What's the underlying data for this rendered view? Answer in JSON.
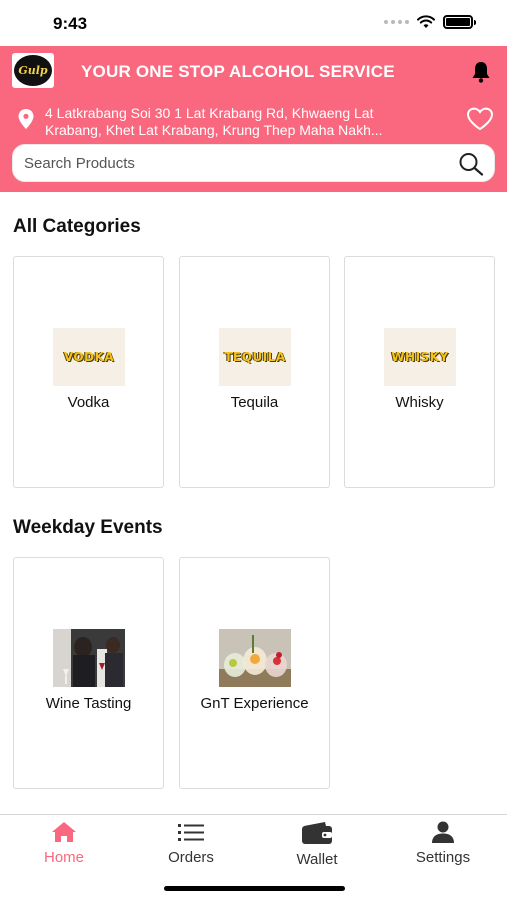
{
  "status_bar": {
    "time": "9:43"
  },
  "header": {
    "tagline": "YOUR ONE STOP ALCOHOL SERVICE",
    "logo_text": "Gulp",
    "address_line1": "4 Latkrabang Soi 30 1 Lat Krabang Rd, Khwaeng Lat",
    "address_line2": "Krabang, Khet Lat Krabang, Krung Thep Maha Nakh...",
    "search_placeholder": "Search Products"
  },
  "categories": {
    "title": "All Categories",
    "items": [
      {
        "label": "Vodka",
        "image_text": "VODKA"
      },
      {
        "label": "Tequila",
        "image_text": "TEQUILA"
      },
      {
        "label": "Whisky",
        "image_text": "WHISKY"
      }
    ]
  },
  "events": {
    "title": "Weekday Events",
    "items": [
      {
        "label": "Wine Tasting"
      },
      {
        "label": "GnT Experience"
      }
    ]
  },
  "bottom_nav": {
    "items": [
      {
        "label": "Home",
        "icon": "home-icon",
        "active": true
      },
      {
        "label": "Orders",
        "icon": "list-icon",
        "active": false
      },
      {
        "label": "Wallet",
        "icon": "wallet-icon",
        "active": false
      },
      {
        "label": "Settings",
        "icon": "person-icon",
        "active": false
      }
    ]
  },
  "colors": {
    "accent": "#f9687e",
    "inactive": "#333333"
  }
}
